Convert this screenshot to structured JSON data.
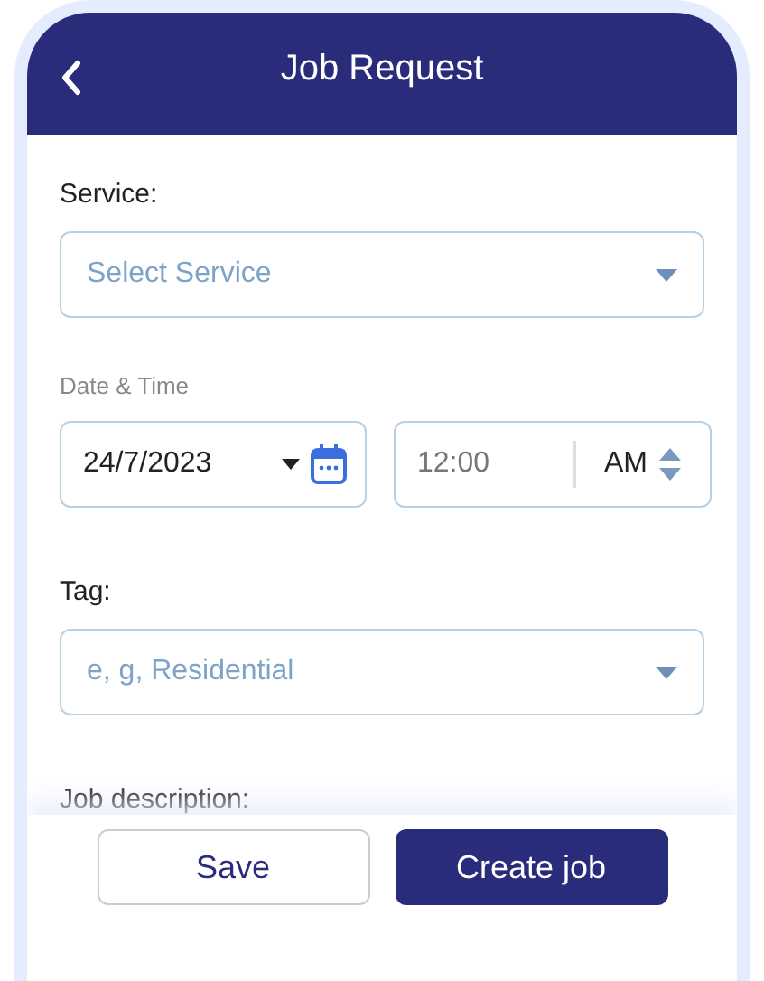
{
  "header": {
    "title": "Job Request"
  },
  "service": {
    "label": "Service:",
    "placeholder": "Select Service"
  },
  "date_time": {
    "label": "Date & Time",
    "date": "24/7/2023",
    "time": "12:00",
    "period": "AM"
  },
  "tag": {
    "label": "Tag:",
    "placeholder": "e, g, Residential"
  },
  "description": {
    "label": "Job description:"
  },
  "buttons": [
    {
      "label": "Save",
      "kind": "secondary"
    },
    {
      "label": "Create job",
      "kind": "primary"
    }
  ]
}
